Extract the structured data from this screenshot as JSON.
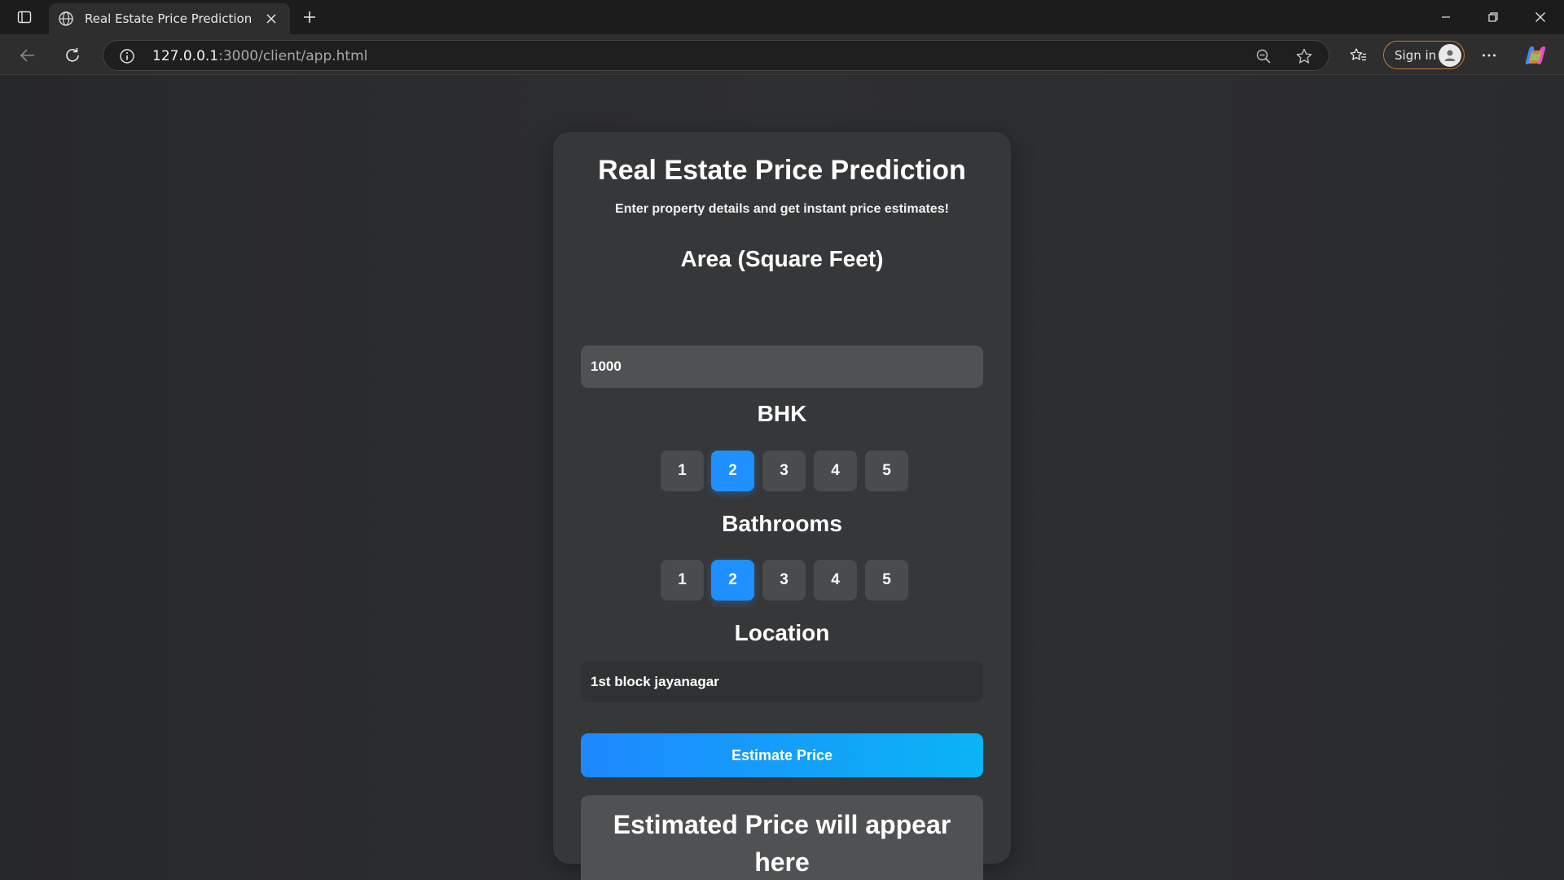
{
  "browser": {
    "tab": {
      "title": "Real Estate Price Prediction"
    },
    "address": {
      "host": "127.0.0.1",
      "path": ":3000/client/app.html"
    },
    "signin_label": "Sign in"
  },
  "app": {
    "title": "Real Estate Price Prediction",
    "subtitle": "Enter property details and get instant price estimates!",
    "area": {
      "label": "Area (Square Feet)",
      "value": "1000"
    },
    "bhk": {
      "label": "BHK",
      "options": [
        "1",
        "2",
        "3",
        "4",
        "5"
      ],
      "selected": "2"
    },
    "bathrooms": {
      "label": "Bathrooms",
      "options": [
        "1",
        "2",
        "3",
        "4",
        "5"
      ],
      "selected": "2"
    },
    "location": {
      "label": "Location",
      "value": "1st block jayanagar"
    },
    "estimate_button": "Estimate Price",
    "result_placeholder": "Estimated Price will appear here"
  },
  "colors": {
    "accent": "#1e90ff",
    "accent_end": "#0ab4f5",
    "card": "#363738",
    "page": "#2b2c2e"
  },
  "icons": [
    "tab-actions-icon",
    "globe-icon",
    "close-icon",
    "plus-icon",
    "minimize-icon",
    "restore-icon",
    "window-close-icon",
    "back-icon",
    "reload-icon",
    "info-icon",
    "zoom-out-icon",
    "star-icon",
    "favorites-icon",
    "avatar-icon",
    "more-icon",
    "copilot-icon"
  ]
}
